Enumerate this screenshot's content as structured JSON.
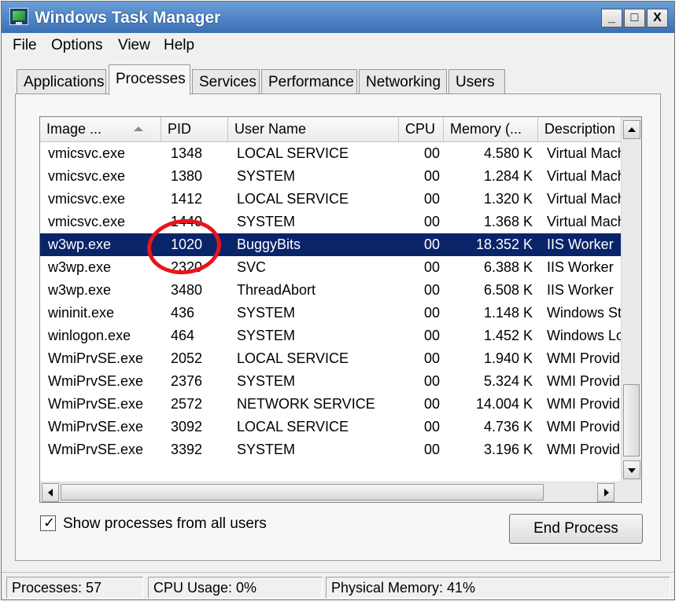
{
  "window": {
    "title": "Windows Task Manager",
    "controls": {
      "minimize": "_",
      "maximize": "□",
      "close": "X"
    }
  },
  "menu": [
    "File",
    "Options",
    "View",
    "Help"
  ],
  "tabs": [
    {
      "label": "Applications",
      "active": false
    },
    {
      "label": "Processes",
      "active": true
    },
    {
      "label": "Services",
      "active": false
    },
    {
      "label": "Performance",
      "active": false
    },
    {
      "label": "Networking",
      "active": false
    },
    {
      "label": "Users",
      "active": false
    }
  ],
  "table": {
    "columns": [
      "Image ...",
      "PID",
      "User Name",
      "CPU",
      "Memory (...",
      "Description"
    ],
    "sorted_column": "Image ...",
    "selected_row": 4,
    "rows": [
      [
        "vmicsvc.exe",
        "1348",
        "LOCAL SERVICE",
        "00",
        "4.580 K",
        "Virtual Mach"
      ],
      [
        "vmicsvc.exe",
        "1380",
        "SYSTEM",
        "00",
        "1.284 K",
        "Virtual Mach"
      ],
      [
        "vmicsvc.exe",
        "1412",
        "LOCAL SERVICE",
        "00",
        "1.320 K",
        "Virtual Mach"
      ],
      [
        "vmicsvc.exe",
        "1440",
        "SYSTEM",
        "00",
        "1.368 K",
        "Virtual Mach"
      ],
      [
        "w3wp.exe",
        "1020",
        "BuggyBits",
        "00",
        "18.352 K",
        "IIS Worker"
      ],
      [
        "w3wp.exe",
        "2320",
        "SVC",
        "00",
        "6.388 K",
        "IIS Worker"
      ],
      [
        "w3wp.exe",
        "3480",
        "ThreadAbort",
        "00",
        "6.508 K",
        "IIS Worker"
      ],
      [
        "wininit.exe",
        "436",
        "SYSTEM",
        "00",
        "1.148 K",
        "Windows St"
      ],
      [
        "winlogon.exe",
        "464",
        "SYSTEM",
        "00",
        "1.452 K",
        "Windows Lo"
      ],
      [
        "WmiPrvSE.exe",
        "2052",
        "LOCAL SERVICE",
        "00",
        "1.940 K",
        "WMI Provid"
      ],
      [
        "WmiPrvSE.exe",
        "2376",
        "SYSTEM",
        "00",
        "5.324 K",
        "WMI Provid"
      ],
      [
        "WmiPrvSE.exe",
        "2572",
        "NETWORK SERVICE",
        "00",
        "14.004 K",
        "WMI Provid"
      ],
      [
        "WmiPrvSE.exe",
        "3092",
        "LOCAL SERVICE",
        "00",
        "4.736 K",
        "WMI Provid"
      ],
      [
        "WmiPrvSE.exe",
        "3392",
        "SYSTEM",
        "00",
        "3.196 K",
        "WMI Provid"
      ]
    ]
  },
  "show_all_users": {
    "label": "Show processes from all users",
    "checked": true
  },
  "end_process_label": "End Process",
  "status": {
    "processes": "Processes: 57",
    "cpu": "CPU Usage: 0%",
    "memory": "Physical Memory: 41%"
  },
  "colors": {
    "selection": "#0a246a",
    "annotation": "#e8141c"
  }
}
